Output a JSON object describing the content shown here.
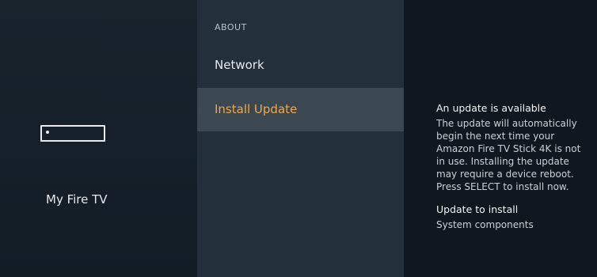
{
  "left_panel": {
    "title": "My Fire TV",
    "device_icon": "fire-tv-stick-icon"
  },
  "middle_panel": {
    "section_header": "ABOUT",
    "items": [
      {
        "label": "Network",
        "selected": false
      },
      {
        "label": "Install Update",
        "selected": true
      }
    ]
  },
  "right_panel": {
    "update_heading": "An update is available",
    "update_description": "The update will automatically\nbegin the next time your\nAmazon Fire TV Stick 4K is not\nin use. Installing the update\nmay require a device reboot.\nPress SELECT to install now.",
    "install_heading": "Update to install",
    "install_value": "System components"
  },
  "colors": {
    "accent": "#f3a847",
    "selected_bg": "#3b4751",
    "middle_bg": "#232f3a",
    "background": "#101820"
  }
}
